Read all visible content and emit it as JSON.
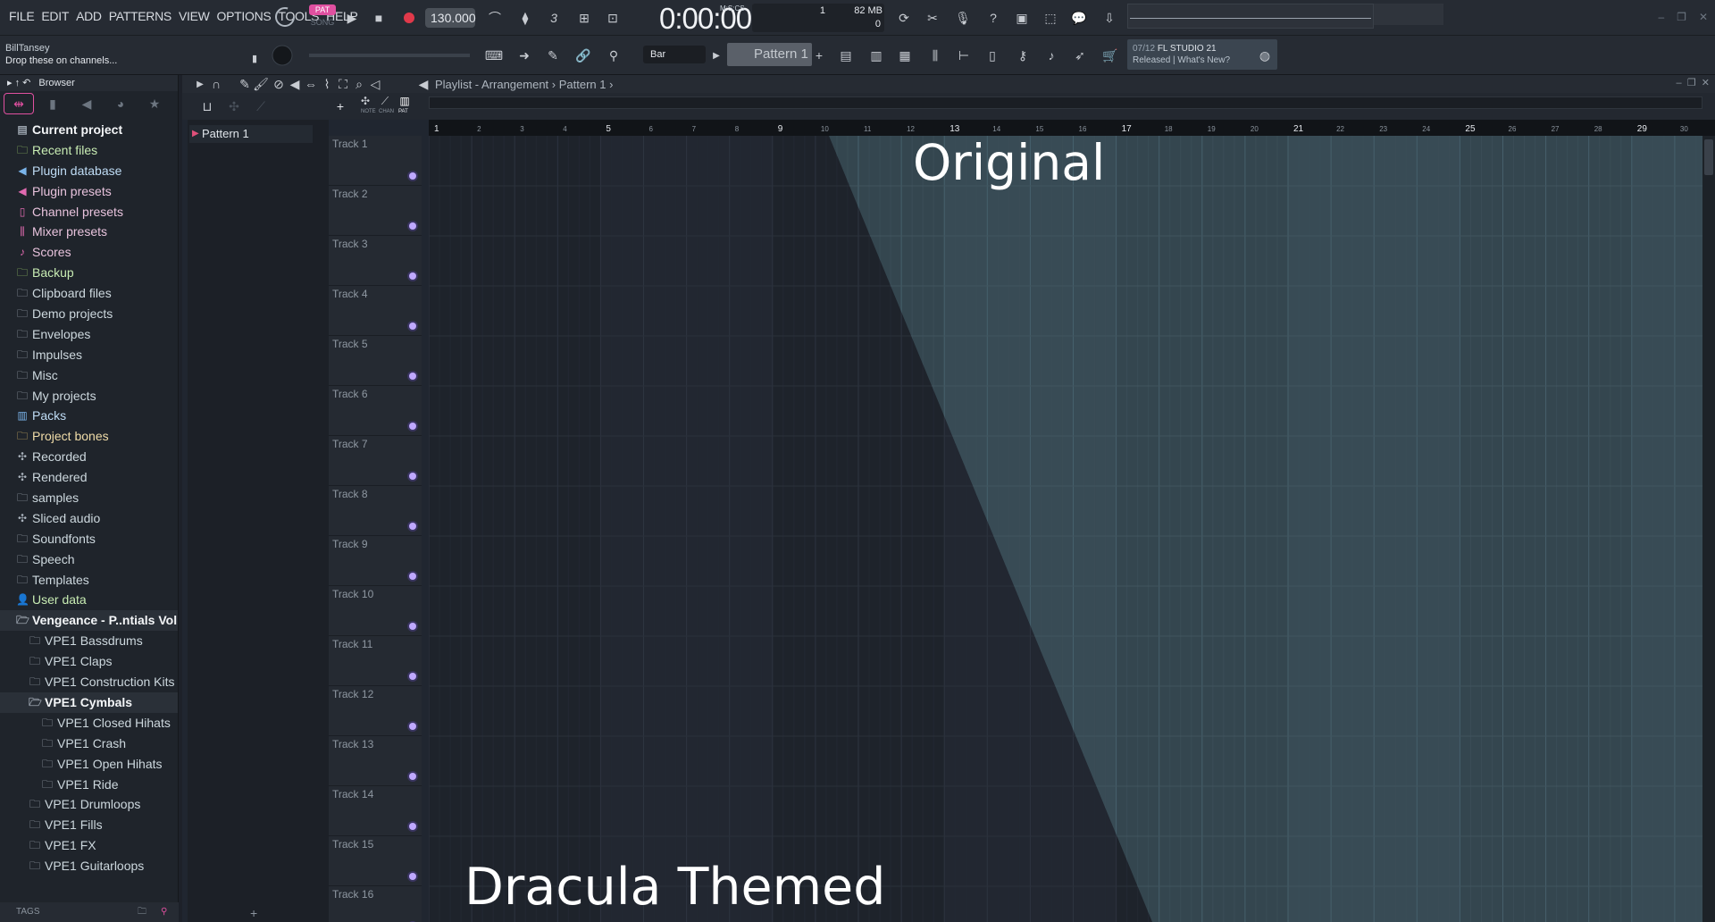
{
  "menu": [
    "FILE",
    "EDIT",
    "ADD",
    "PATTERNS",
    "VIEW",
    "OPTIONS",
    "TOOLS",
    "HELP"
  ],
  "transport": {
    "pat_label": "PAT",
    "song_label": "SONG",
    "tempo": "130.000",
    "time": "0:00:00",
    "time_unit": "M:S:CS",
    "cpu_top": "1",
    "memory": "82 MB",
    "poly": "0"
  },
  "hint": {
    "user": "BillTansey",
    "text": "Drop these on channels..."
  },
  "toolbar": {
    "snap": "Bar",
    "pattern": "Pattern 1"
  },
  "news": {
    "date": "07/12",
    "title": "FL STUDIO 21",
    "status": "Released | What's New?"
  },
  "browser": {
    "title": "Browser",
    "tags_label": "TAGS",
    "items": [
      {
        "label": "Current project",
        "icon": "project-icon",
        "style": "bold"
      },
      {
        "label": "Recent files",
        "icon": "recent-files-icon",
        "style": "g"
      },
      {
        "label": "Plugin database",
        "icon": "plugin-database-icon",
        "style": "b"
      },
      {
        "label": "Plugin presets",
        "icon": "plugin-presets-icon",
        "style": "p"
      },
      {
        "label": "Channel presets",
        "icon": "channel-presets-icon",
        "style": "p"
      },
      {
        "label": "Mixer presets",
        "icon": "mixer-presets-icon",
        "style": "p"
      },
      {
        "label": "Scores",
        "icon": "scores-icon",
        "style": "p"
      },
      {
        "label": "Backup",
        "icon": "backup-icon",
        "style": "g"
      },
      {
        "label": "Clipboard files",
        "icon": "folder-icon",
        "style": "w"
      },
      {
        "label": "Demo projects",
        "icon": "folder-icon",
        "style": "w"
      },
      {
        "label": "Envelopes",
        "icon": "folder-icon",
        "style": "w"
      },
      {
        "label": "Impulses",
        "icon": "folder-icon",
        "style": "w"
      },
      {
        "label": "Misc",
        "icon": "folder-icon",
        "style": "w"
      },
      {
        "label": "My projects",
        "icon": "folder-icon",
        "style": "w"
      },
      {
        "label": "Packs",
        "icon": "packs-icon",
        "style": "b"
      },
      {
        "label": "Project bones",
        "icon": "folder-icon",
        "style": "y"
      },
      {
        "label": "Recorded",
        "icon": "recorded-icon",
        "style": "w"
      },
      {
        "label": "Rendered",
        "icon": "rendered-icon",
        "style": "w"
      },
      {
        "label": "samples",
        "icon": "folder-icon",
        "style": "w"
      },
      {
        "label": "Sliced audio",
        "icon": "sliced-audio-icon",
        "style": "w"
      },
      {
        "label": "Soundfonts",
        "icon": "folder-icon",
        "style": "w"
      },
      {
        "label": "Speech",
        "icon": "folder-icon",
        "style": "w"
      },
      {
        "label": "Templates",
        "icon": "folder-icon",
        "style": "w"
      },
      {
        "label": "User data",
        "icon": "user-data-icon",
        "style": "g"
      },
      {
        "label": "Vengeance - P..ntials Vol.1",
        "icon": "folder-open-icon",
        "style": "bold"
      },
      {
        "label": "VPE1 Bassdrums",
        "icon": "folder-icon",
        "style": "w",
        "indent": 1
      },
      {
        "label": "VPE1 Claps",
        "icon": "folder-icon",
        "style": "w",
        "indent": 1
      },
      {
        "label": "VPE1 Construction Kits",
        "icon": "folder-icon",
        "style": "w",
        "indent": 1
      },
      {
        "label": "VPE1 Cymbals",
        "icon": "folder-open-icon",
        "style": "bold",
        "indent": 1
      },
      {
        "label": "VPE1 Closed Hihats",
        "icon": "folder-icon",
        "style": "w",
        "indent": 2
      },
      {
        "label": "VPE1 Crash",
        "icon": "folder-icon",
        "style": "w",
        "indent": 2
      },
      {
        "label": "VPE1 Open Hihats",
        "icon": "folder-icon",
        "style": "w",
        "indent": 2
      },
      {
        "label": "VPE1 Ride",
        "icon": "folder-icon",
        "style": "w",
        "indent": 2
      },
      {
        "label": "VPE1 Drumloops",
        "icon": "folder-icon",
        "style": "w",
        "indent": 1
      },
      {
        "label": "VPE1 Fills",
        "icon": "folder-icon",
        "style": "w",
        "indent": 1
      },
      {
        "label": "VPE1 FX",
        "icon": "folder-icon",
        "style": "w",
        "indent": 1
      },
      {
        "label": "VPE1 Guitarloops",
        "icon": "folder-icon",
        "style": "w",
        "indent": 1
      }
    ]
  },
  "playlist": {
    "breadcrumb": "Playlist - Arrangement › Pattern 1 ›",
    "pattern_item": "Pattern 1",
    "sub_tabs": [
      "NOTE",
      "CHAN",
      "PAT"
    ],
    "bars": [
      "1",
      "2",
      "3",
      "4",
      "5",
      "6",
      "7",
      "8",
      "9",
      "10",
      "11",
      "12",
      "13",
      "14",
      "15",
      "16",
      "17",
      "18",
      "19",
      "20",
      "21",
      "22",
      "23",
      "24",
      "25",
      "26",
      "27",
      "28",
      "29",
      "30"
    ],
    "tracks": [
      "Track 1",
      "Track 2",
      "Track 3",
      "Track 4",
      "Track 5",
      "Track 6",
      "Track 7",
      "Track 8",
      "Track 9",
      "Track 10",
      "Track 11",
      "Track 12",
      "Track 13",
      "Track 14",
      "Track 15",
      "Track 16"
    ]
  },
  "overlay": {
    "original": "Original",
    "dracula": "Dracula Themed"
  },
  "colors": {
    "accent": "#e050a0",
    "dracula_bg": "#1e232b",
    "original_bg": "#34464f"
  }
}
